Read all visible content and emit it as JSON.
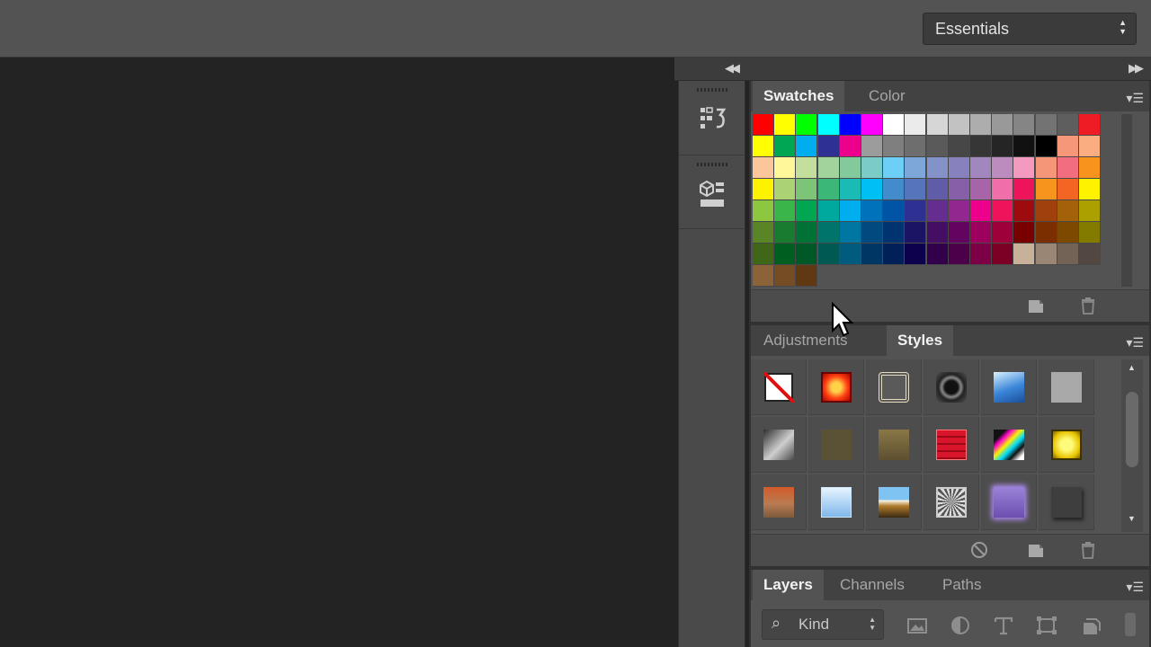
{
  "workspace": {
    "selected": "Essentials"
  },
  "dock": {
    "collapse_icon": "double-chevron-left-icon",
    "expand_icon": "double-chevron-right-icon"
  },
  "icon_column": {
    "icons": [
      "history-icon",
      "3d-properties-icon"
    ]
  },
  "swatches_panel": {
    "tabs": [
      "Swatches",
      "Color"
    ],
    "active_tab": "Swatches",
    "footer_icons": [
      "new-swatch-icon",
      "trash-icon"
    ],
    "rows": [
      [
        "#ff0000",
        "#ffff00",
        "#00ff00",
        "#00ffff",
        "#0000ff",
        "#ff00ff",
        "#ffffff",
        "#ebebeb",
        "#d6d6d6",
        "#c2c2c2",
        "#adadad",
        "#999999",
        "#858585",
        "#737373",
        "#5e5e5e",
        "#ee1c24"
      ],
      [
        "#ffff00",
        "#00a651",
        "#00aeef",
        "#2e3192",
        "#ec008c",
        "#9c9c9c",
        "#7f7f7f",
        "#6e6e6e",
        "#5a5a5a",
        "#474747",
        "#363636",
        "#252525",
        "#111111",
        "#000000",
        "#f7977a",
        "#f9ad81"
      ],
      [
        "#fbc699",
        "#fff799",
        "#c4df9b",
        "#a3d39c",
        "#82ca9c",
        "#7accc8",
        "#6dcff6",
        "#7da7d9",
        "#8393ca",
        "#8781bd",
        "#a187be",
        "#bd8cbf",
        "#f49ac1",
        "#f69679",
        "#f26d7d",
        "#f8941d"
      ],
      [
        "#fff200",
        "#acd373",
        "#7cc576",
        "#3bb878",
        "#1abbb4",
        "#00bff3",
        "#438ccb",
        "#5574b9",
        "#605ca8",
        "#855fa8",
        "#a864a8",
        "#f06eaa",
        "#ed145b",
        "#f7941d",
        "#f26522",
        "#fff200"
      ],
      [
        "#8dc63f",
        "#39b54a",
        "#00a651",
        "#00a99d",
        "#00aeef",
        "#0072bc",
        "#0054a6",
        "#2e3192",
        "#662d91",
        "#92278f",
        "#ec008c",
        "#ed145b",
        "#9e0b0f",
        "#a0410d",
        "#a3620a",
        "#aba000"
      ],
      [
        "#598527",
        "#197b30",
        "#007236",
        "#00746b",
        "#0076a3",
        "#004a80",
        "#003471",
        "#1b1464",
        "#440e62",
        "#630460",
        "#9e005d",
        "#9e0039",
        "#790000",
        "#7b2e00",
        "#7d4900",
        "#827b00"
      ],
      [
        "#406618",
        "#005e20",
        "#005826",
        "#005952",
        "#005b7f",
        "#003663",
        "#002157",
        "#0d004c",
        "#32004b",
        "#4b0049",
        "#7b0046",
        "#7a0026",
        "#c7b299",
        "#998675",
        "#736357",
        "#534741"
      ],
      [
        "#8c6239",
        "#754c24",
        "#603913"
      ]
    ]
  },
  "styles_panel": {
    "tabs": [
      "Adjustments",
      "Styles"
    ],
    "active_tab": "Styles",
    "items": [
      "none-style",
      "red-bevel-style",
      "double-ring-style",
      "black-chrome-style",
      "blue-glass-style",
      "gray-flat-style",
      "metal-gradient-style",
      "olive-flat-style",
      "gold-gradient-style",
      "red-striped-style",
      "rainbow-chrome-style",
      "yellow-bevel-style",
      "sunset-texture-style",
      "sky-gradient-style",
      "landscape-style",
      "sketch-style",
      "purple-glow-style",
      "dark-shadow-style"
    ],
    "footer_icons": [
      "clear-style-icon",
      "new-style-icon",
      "trash-icon"
    ]
  },
  "layers_panel": {
    "tabs": [
      "Layers",
      "Channels",
      "Paths"
    ],
    "active_tab": "Layers",
    "filter_label": "Kind",
    "filter_tools": [
      "image-filter-icon",
      "adjustment-filter-icon",
      "type-filter-icon",
      "shape-filter-icon",
      "smart-object-filter-icon"
    ]
  },
  "colors": {
    "app_bg": "#232323",
    "panel": "#535353",
    "tab_bar": "#424242"
  }
}
